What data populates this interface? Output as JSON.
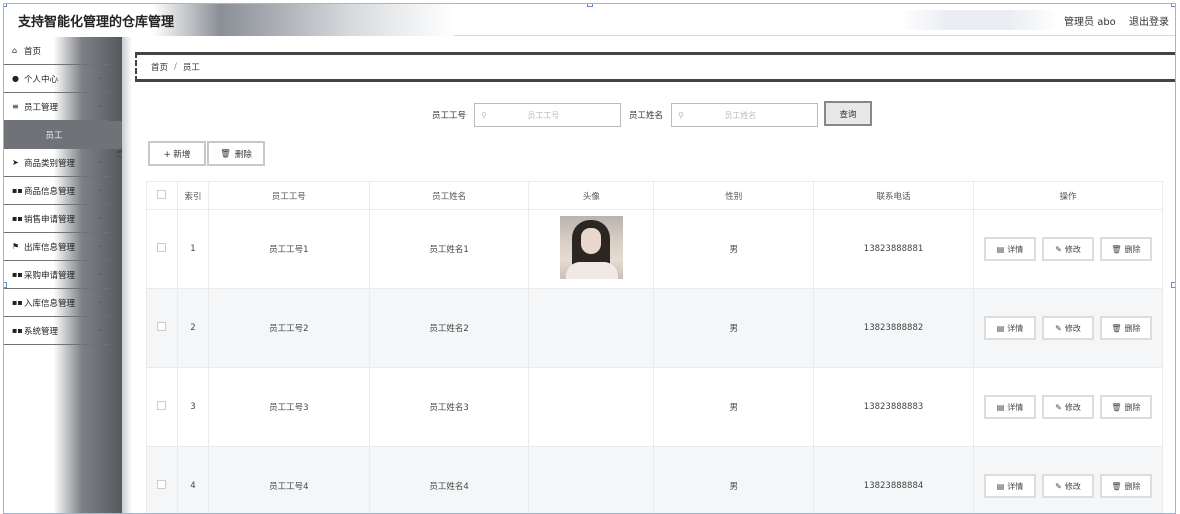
{
  "header": {
    "title": "支持智能化管理的仓库管理",
    "user": "管理员 abo",
    "logout": "退出登录"
  },
  "sidebar": {
    "items": [
      {
        "label": "首页",
        "icon": "home-icon",
        "glyph": "⌂",
        "arrow": false
      },
      {
        "label": "个人中心",
        "icon": "user-icon",
        "glyph": "●",
        "arrow": true
      },
      {
        "label": "员工管理",
        "icon": "menu-icon",
        "glyph": "≡",
        "arrow": true,
        "sub": "员工"
      },
      {
        "label": "商品类别管理",
        "icon": "send-icon",
        "glyph": "➤",
        "arrow": true
      },
      {
        "label": "商品信息管理",
        "icon": "grid-icon",
        "glyph": "▪▪",
        "arrow": true
      },
      {
        "label": "销售申请管理",
        "icon": "grid-icon",
        "glyph": "▪▪",
        "arrow": true
      },
      {
        "label": "出库信息管理",
        "icon": "flag-icon",
        "glyph": "⚑",
        "arrow": true
      },
      {
        "label": "采购申请管理",
        "icon": "grid-icon",
        "glyph": "▪▪",
        "arrow": true
      },
      {
        "label": "入库信息管理",
        "icon": "grid-icon",
        "glyph": "▪▪",
        "arrow": true
      },
      {
        "label": "系统管理",
        "icon": "grid-icon",
        "glyph": "▪▪",
        "arrow": true
      }
    ]
  },
  "breadcrumb": {
    "home": "首页",
    "separator": "/",
    "current": "员工"
  },
  "search": {
    "field1_label": "员工工号",
    "field1_placeholder": "员工工号",
    "field2_label": "员工姓名",
    "field2_placeholder": "员工姓名",
    "button": "查询"
  },
  "toolbar": {
    "add": "+ 新增",
    "delete": "删除"
  },
  "table": {
    "headers": [
      "索引",
      "员工工号",
      "员工姓名",
      "头像",
      "性别",
      "联系电话",
      "操作"
    ],
    "rows": [
      {
        "index": "1",
        "id": "员工工号1",
        "name": "员工姓名1",
        "avatar": true,
        "gender": "男",
        "phone": "13823888881"
      },
      {
        "index": "2",
        "id": "员工工号2",
        "name": "员工姓名2",
        "avatar": false,
        "gender": "男",
        "phone": "13823888882"
      },
      {
        "index": "3",
        "id": "员工工号3",
        "name": "员工姓名3",
        "avatar": false,
        "gender": "男",
        "phone": "13823888883"
      },
      {
        "index": "4",
        "id": "员工工号4",
        "name": "员工姓名4",
        "avatar": false,
        "gender": "男",
        "phone": "13823888884"
      }
    ],
    "actions": {
      "detail": "详情",
      "edit": "修改",
      "delete": "删除"
    }
  }
}
